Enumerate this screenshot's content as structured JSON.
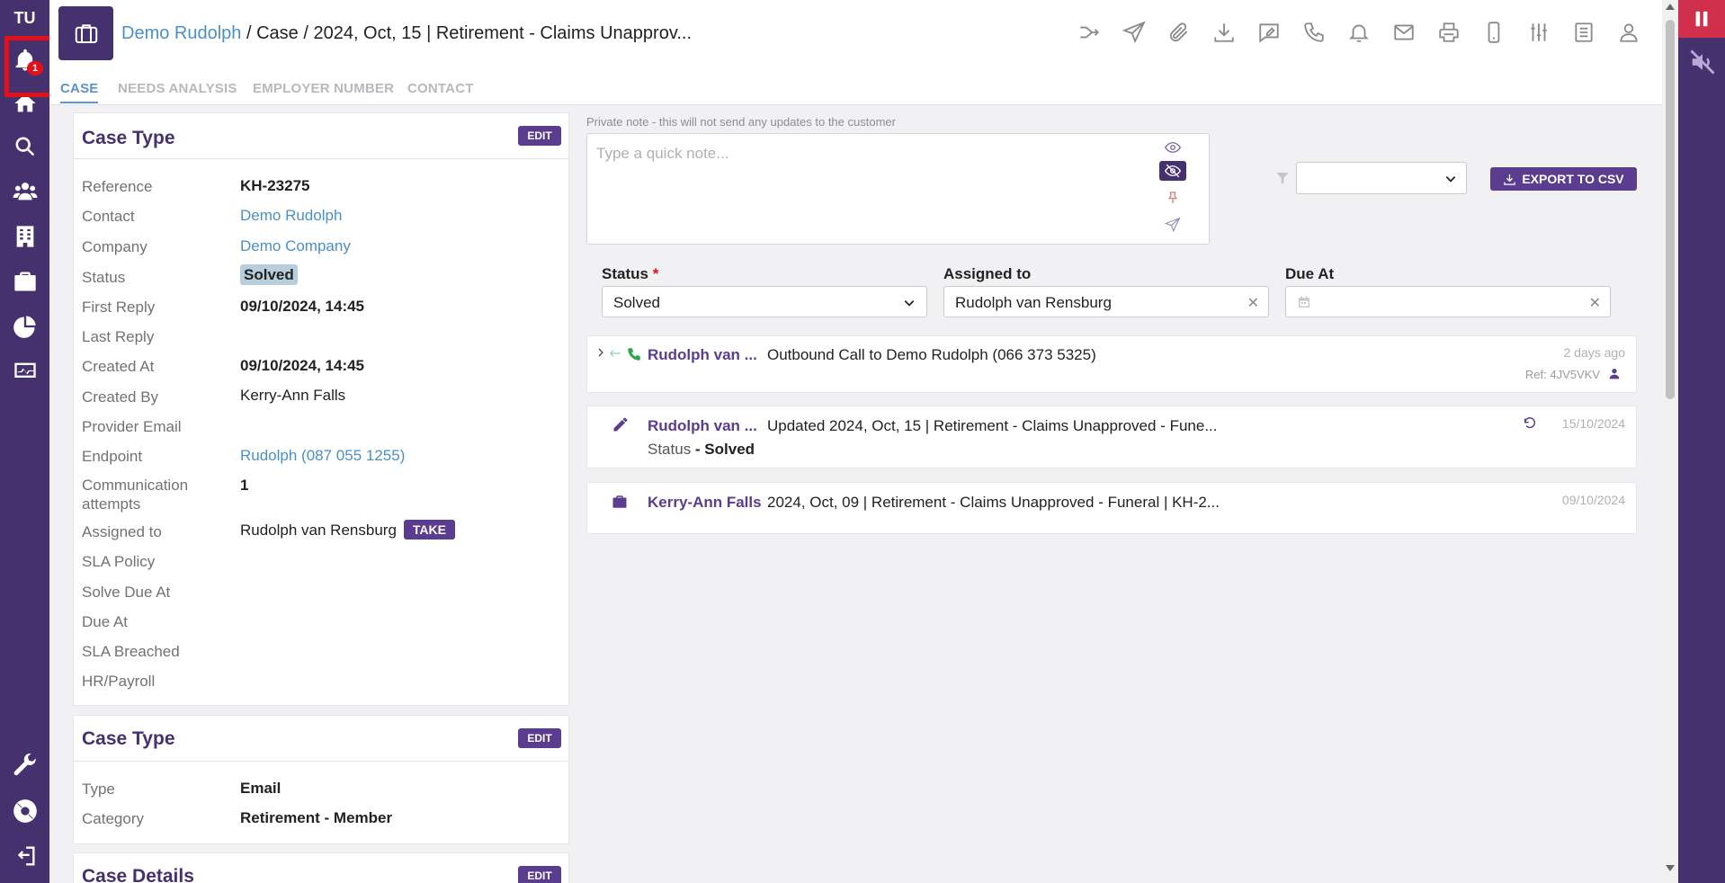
{
  "sidebar": {
    "initials": "TU",
    "notification_count": "1",
    "items": [
      {
        "icon": "bell-icon"
      },
      {
        "icon": "home-icon"
      },
      {
        "icon": "search-icon"
      },
      {
        "icon": "users-icon"
      },
      {
        "icon": "building-icon"
      },
      {
        "icon": "briefcase-icon"
      },
      {
        "icon": "pie-chart-icon"
      },
      {
        "icon": "monitor-icon"
      },
      {
        "icon": "wrench-icon"
      },
      {
        "icon": "support-icon"
      },
      {
        "icon": "logout-icon"
      }
    ]
  },
  "header": {
    "contact_link": "Demo Rudolph",
    "path": " / Case / 2024, Oct, 15 | Retirement - Claims Unapprov..."
  },
  "tabs": [
    {
      "label": "CASE"
    },
    {
      "label": "NEEDS ANALYSIS"
    },
    {
      "label": "EMPLOYER NUMBER"
    },
    {
      "label": "CONTACT"
    }
  ],
  "case_type_card": {
    "title": "Case Type",
    "edit_label": "EDIT",
    "fields": [
      {
        "label": "Reference",
        "value": "KH-23275"
      },
      {
        "label": "Contact",
        "value": "Demo Rudolph"
      },
      {
        "label": "Company",
        "value": "Demo Company"
      },
      {
        "label": "Status",
        "value": "Solved"
      },
      {
        "label": "First Reply",
        "value": "09/10/2024, 14:45"
      },
      {
        "label": "Last Reply",
        "value": ""
      },
      {
        "label": "Created At",
        "value": "09/10/2024, 14:45"
      },
      {
        "label": "Created By",
        "value": "Kerry-Ann Falls"
      },
      {
        "label": "Provider Email",
        "value": ""
      },
      {
        "label": "Endpoint",
        "value": "Rudolph (087 055 1255)"
      },
      {
        "label": "Communication",
        "label2": "attempts",
        "value": "1"
      },
      {
        "label": "Assigned to",
        "value": "Rudolph van Rensburg"
      },
      {
        "label": "SLA Policy",
        "value": ""
      },
      {
        "label": "Solve Due At",
        "value": ""
      },
      {
        "label": "Due At",
        "value": ""
      },
      {
        "label": "SLA Breached",
        "value": ""
      },
      {
        "label": "HR/Payroll",
        "value": ""
      }
    ],
    "take_label": "TAKE"
  },
  "case_type_card2": {
    "title": "Case Type",
    "edit_label": "EDIT",
    "fields": [
      {
        "label": "Type",
        "value": "Email"
      },
      {
        "label": "Category",
        "value": "Retirement - Member"
      }
    ]
  },
  "case_details_card": {
    "title": "Case Details",
    "edit_label": "EDIT"
  },
  "note": {
    "caption": "Private note - this will not send any updates to the customer",
    "placeholder": "Type a quick note..."
  },
  "export": {
    "label": "EXPORT TO CSV",
    "filter_value": ""
  },
  "form": {
    "status_label": "Status",
    "status_required": "*",
    "status_value": "Solved",
    "assigned_label": "Assigned to",
    "assigned_value": "Rudolph van Rensburg",
    "due_label": "Due At",
    "due_value": ""
  },
  "timeline": [
    {
      "author": "Rudolph van ...",
      "text": "Outbound Call to Demo Rudolph (066 373 5325)",
      "date": "2 days ago",
      "ref": "Ref: 4JV5VKV"
    },
    {
      "author": "Rudolph van ...",
      "text": "Updated 2024, Oct, 15 | Retirement - Claims Unapproved - Fune...",
      "sub_label": "Status",
      "sub_value": " - Solved",
      "date": "15/10/2024"
    },
    {
      "author": "Kerry-Ann Falls",
      "text": "2024, Oct, 09 | Retirement - Claims Unapproved - Funeral | KH-2...",
      "date": "09/10/2024"
    }
  ],
  "colors": {
    "brand": "#46316f",
    "button": "#5a3d8f",
    "link": "#4a90c8",
    "highlight": "#e3101a"
  }
}
